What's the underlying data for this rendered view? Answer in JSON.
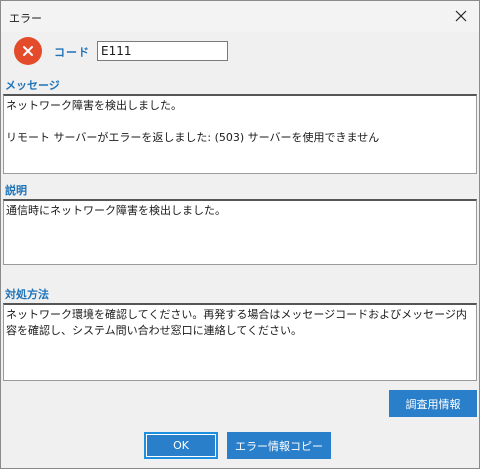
{
  "window": {
    "title": "エラー"
  },
  "code": {
    "label": "コード",
    "value": "E111"
  },
  "message": {
    "label": "メッセージ",
    "text": "ネットワーク障害を検出しました。\n\nリモート サーバーがエラーを返しました: (503) サーバーを使用できません"
  },
  "description": {
    "label": "説明",
    "text": "通信時にネットワーク障害を検出しました。"
  },
  "solution": {
    "label": "対処方法",
    "text": "ネットワーク環境を確認してください。再発する場合はメッセージコードおよびメッセージ内容を確認し、システム問い合わせ窓口に連絡してください。"
  },
  "buttons": {
    "debug_info": "調査用情報",
    "ok": "OK",
    "copy_error": "エラー情報コピー"
  },
  "icons": {
    "error": "error-x-icon",
    "close": "close-icon"
  },
  "colors": {
    "accent": "#1f73b8",
    "button": "#2a7fcb",
    "error": "#e44b2a"
  }
}
